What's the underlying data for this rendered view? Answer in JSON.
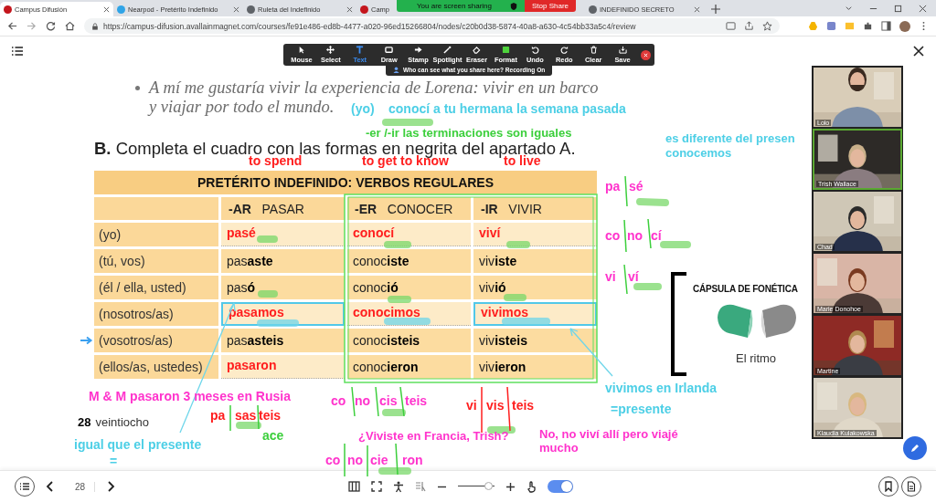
{
  "browser": {
    "tabs": [
      {
        "label": "Campus Difusión",
        "selected": true
      },
      {
        "label": "Nearpod - Pretérito Indefinido",
        "selected": false
      },
      {
        "label": "Ruleta del Indefinido",
        "selected": false
      },
      {
        "label": "Camp",
        "selected": false
      },
      {
        "label": "INDEFINIDO SECRETO",
        "selected": false
      }
    ],
    "url": "https://campus-difusion.avallainmagnet.com/courses/fe91e486-ed8b-4477-a020-96ed15266804/nodes/c20b0d38-5874-40a8-a630-4c54bb33a5c4/review"
  },
  "share_banner": {
    "status": "You are screen sharing",
    "stop": "Stop Share"
  },
  "annotate_toolbar": {
    "tools": [
      {
        "label": "Mouse",
        "selected": false
      },
      {
        "label": "Select",
        "selected": false
      },
      {
        "label": "Text",
        "selected": true
      },
      {
        "label": "Draw",
        "selected": false
      },
      {
        "label": "Stamp",
        "selected": false
      },
      {
        "label": "Spotlight",
        "selected": false
      },
      {
        "label": "Eraser",
        "selected": false
      },
      {
        "label": "Format",
        "selected": false
      },
      {
        "label": "Undo",
        "selected": false
      },
      {
        "label": "Redo",
        "selected": false
      },
      {
        "label": "Clear",
        "selected": false
      },
      {
        "label": "Save",
        "selected": false
      }
    ],
    "notice": "Who can see what you share here? Recording On"
  },
  "page": {
    "bullet_lines": [
      "A mí me gustaría vivir la experiencia de Lorena: vivir en un barco",
      "y viajar por todo el mundo."
    ],
    "heading": "**B.** Completa el cuadro con las formas en negrita del apartado A.",
    "table": {
      "title": "PRETÉRITO INDEFINIDO: VERBOS REGULARES",
      "columns": [
        "**-AR**   PASAR",
        "**-ER**   CONOCER",
        "**-IR**   VIVIR"
      ],
      "rows": [
        {
          "person": "(yo)",
          "cells": [
            {
              "text": "pasé",
              "kind": "written",
              "outlined": false
            },
            {
              "text": "conocí",
              "kind": "written",
              "outlined": false
            },
            {
              "text": "viví",
              "kind": "written",
              "outlined": false
            }
          ]
        },
        {
          "person": "(tú, vos)",
          "cells": [
            {
              "text": "pas**aste**",
              "kind": "printed",
              "outlined": false
            },
            {
              "text": "conoc**iste**",
              "kind": "printed",
              "outlined": false
            },
            {
              "text": "viv**iste**",
              "kind": "printed",
              "outlined": false
            }
          ]
        },
        {
          "person": "(él / ella, usted)",
          "cells": [
            {
              "text": "pas**ó**",
              "kind": "printed",
              "outlined": false
            },
            {
              "text": "conoc**ió**",
              "kind": "printed",
              "outlined": false
            },
            {
              "text": "viv**ió**",
              "kind": "printed",
              "outlined": false
            }
          ]
        },
        {
          "person": "(nosotros/as)",
          "cells": [
            {
              "text": "pasamos",
              "kind": "written",
              "outlined": true
            },
            {
              "text": "conocimos",
              "kind": "written",
              "outlined": false
            },
            {
              "text": "vivimos",
              "kind": "written",
              "outlined": true
            }
          ]
        },
        {
          "person": "(vosotros/as)",
          "cells": [
            {
              "text": "pas**asteis**",
              "kind": "printed",
              "outlined": false
            },
            {
              "text": "conoc**isteis**",
              "kind": "printed",
              "outlined": false
            },
            {
              "text": "viv**isteis**",
              "kind": "printed",
              "outlined": false
            }
          ]
        },
        {
          "person": "(ellos/as, ustedes)",
          "cells": [
            {
              "text": "pasaron",
              "kind": "written",
              "outlined": false
            },
            {
              "text": "conoc**ieron**",
              "kind": "printed",
              "outlined": false
            },
            {
              "text": "viv**ieron**",
              "kind": "printed",
              "outlined": false
            }
          ]
        }
      ]
    },
    "page_number": "28",
    "page_word": "veintiocho",
    "capsule": {
      "title": "CÁPSULA DE FONÉTICA",
      "caption": "El ritmo"
    }
  },
  "annotations": [
    {
      "text": "(yo)",
      "color": "#4dcfe6"
    },
    {
      "text": "conocí a tu hermana la semana pasada",
      "color": "#4dcfe6"
    },
    {
      "text": "-er /-ir las terminaciones son iguales",
      "color": "#3ccf3c"
    },
    {
      "text": "es diferente del presen",
      "color": "#4dcfe6"
    },
    {
      "text": "conocemos",
      "color": "#4dcfe6"
    },
    {
      "text": "to spend",
      "color": "#ff1e1e"
    },
    {
      "text": "to get to know",
      "color": "#ff1e1e"
    },
    {
      "text": "to live",
      "color": "#ff1e1e"
    },
    {
      "text": "pa",
      "color": "#ff33cc"
    },
    {
      "text": "sé",
      "color": "#ff33cc"
    },
    {
      "text": "co",
      "color": "#ff33cc"
    },
    {
      "text": "no",
      "color": "#ff33cc"
    },
    {
      "text": "cí",
      "color": "#ff33cc"
    },
    {
      "text": "vi",
      "color": "#ff33cc"
    },
    {
      "text": "ví",
      "color": "#ff33cc"
    },
    {
      "text": "vivimos en Irlanda",
      "color": "#4dcfe6"
    },
    {
      "text": "=presente",
      "color": "#4dcfe6"
    },
    {
      "text": "No, no viví allí pero viajé mucho",
      "color": "#ff33cc"
    },
    {
      "text": "M & M pasaron 3 meses en Rusia",
      "color": "#ff33cc"
    },
    {
      "text": "pa",
      "color": "#ff1e1e"
    },
    {
      "text": "sas",
      "color": "#ff1e1e"
    },
    {
      "text": "teis",
      "color": "#ff1e1e"
    },
    {
      "text": "ace",
      "color": "#3ccf3c"
    },
    {
      "text": "igual que el presente",
      "color": "#4dcfe6"
    },
    {
      "text": "=",
      "color": "#4dcfe6"
    },
    {
      "text": "co",
      "color": "#ff33cc"
    },
    {
      "text": "no",
      "color": "#ff33cc"
    },
    {
      "text": "cis",
      "color": "#ff33cc"
    },
    {
      "text": "teis",
      "color": "#ff33cc"
    },
    {
      "text": "vi",
      "color": "#ff1e1e"
    },
    {
      "text": "vis",
      "color": "#ff1e1e"
    },
    {
      "text": "teis",
      "color": "#ff1e1e"
    },
    {
      "text": "¿Viviste en Francia, Trish?",
      "color": "#ff33cc"
    },
    {
      "text": "co",
      "color": "#ff33cc"
    },
    {
      "text": "no",
      "color": "#ff33cc"
    },
    {
      "text": "cie",
      "color": "#ff33cc"
    },
    {
      "text": "ron",
      "color": "#ff33cc"
    }
  ],
  "participants": [
    {
      "name": "Lolo",
      "speaking": false
    },
    {
      "name": "Trish Wallace",
      "speaking": true
    },
    {
      "name": "Chad",
      "speaking": false
    },
    {
      "name": "Marie Donohoe",
      "speaking": false
    },
    {
      "name": "Martine",
      "speaking": false
    },
    {
      "name": "Klaudia Kulakowska",
      "speaking": false
    }
  ],
  "bottom_bar": {
    "page": "28",
    "zoom": {
      "level": 0.85
    },
    "touch_mode": {
      "on": true
    }
  }
}
